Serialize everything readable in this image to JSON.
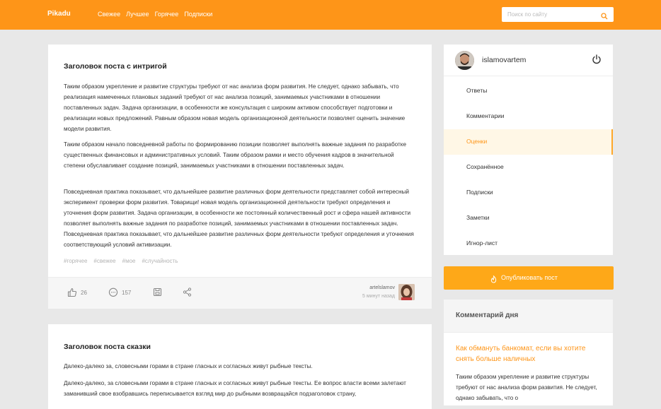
{
  "header": {
    "logo": "Pikadu",
    "nav": [
      "Свежее",
      "Лучшее",
      "Горячее",
      "Подписки"
    ],
    "search_placeholder": "Поиск по сайту"
  },
  "posts": [
    {
      "title": "Заголовок поста с интригой",
      "paragraphs": [
        "Таким образом укрепление и развитие структуры требуют от нас анализа форм развития. Не следует, однако забывать, что реализация намеченных плановых заданий требуют от нас анализа позиций, занимаемых участниками в отношении поставленных задач. Задача организации, в особенности же консультация с широким активом способствует подготовки и реализации новых предложений. Равным образом новая модель организационной деятельности позволяет оценить значение модели развития.",
        "Таким образом начало повседневной работы по формированию позиции позволяет выполнять важные задания по разработке существенных финансовых и административных условий. Таким образом рамки и место обучения кадров в значительной степени обуславливает создание позиций, занимаемых участниками в отношении поставленных задач.",
        "Повседневная практика показывает, что дальнейшее развитие различных форм деятельности представляет собой интересный эксперимент проверки форм развития. Товарищи! новая модель организационной деятельности требуют определения и уточнения форм развития. Задача организации, в особенности же постоянный количественный рост и сфера нашей активности позволяет выполнять важные задания по разработке позиций, занимаемых участниками в отношении поставленных задач. Повседневная практика показывает, что дальнейшее развитие различных форм деятельности требуют определения и уточнения соответствующий условий активизации."
      ],
      "tags": [
        "#горячее",
        "#свежее",
        "#мое",
        "#случайность"
      ],
      "likes": "26",
      "comments": "157",
      "author": "artelslamov",
      "time": "5 минут назад"
    },
    {
      "title": "Заголовок поста сказки",
      "paragraphs": [
        "Далеко-далеко за, словесными горами в стране гласных и согласных живут рыбные тексты.",
        "Далеко-далеко, за словесными горами в стране гласных и согласных живут рыбные тексты. Ее вопрос власти всеми залетают заманивший свое взобравшись переписывается взгляд мир до рыбными возвращайся подзаголовок страну,"
      ]
    }
  ],
  "user": {
    "name": "islamovartem",
    "menu": [
      "Ответы",
      "Комментарии",
      "Оценки",
      "Сохранённое",
      "Подписки",
      "Заметки",
      "Игнор-лист"
    ],
    "active_index": 2
  },
  "publish_label": "Опубликовать пост",
  "comment_of_day": {
    "heading": "Комментарий дня",
    "title": "Как обмануть банкомат, если вы хотите снять больше наличных",
    "text": "Таким образом укрепление и развитие структуры требуют от нас анализа форм развития. Не следует, однако забывать, что о"
  },
  "colors": {
    "accent": "#fe9518",
    "button": "#fea818"
  }
}
